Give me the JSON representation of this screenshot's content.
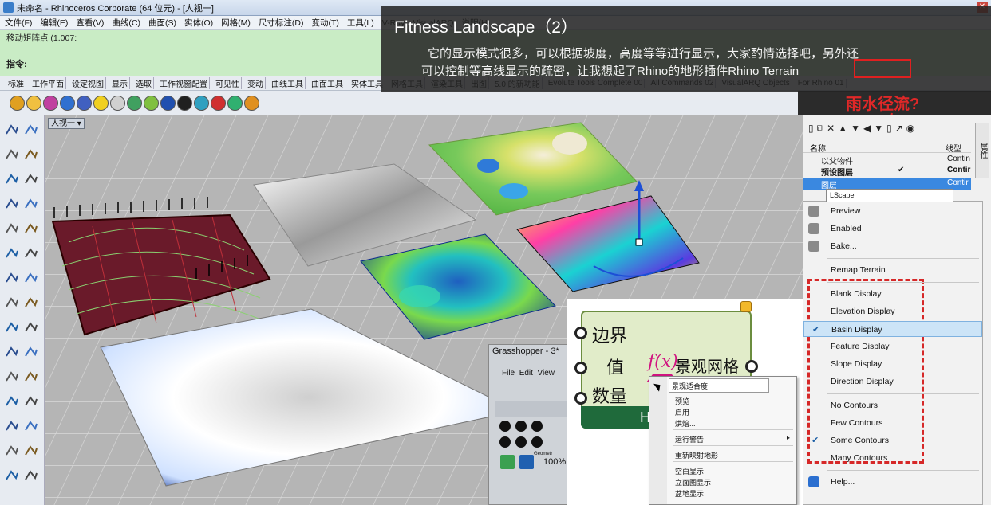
{
  "window": {
    "title": "未命名 - Rhinoceros Corporate (64 位元) - [人视一]",
    "close_glyph": "✕"
  },
  "menu": [
    "文件(F)",
    "编辑(E)",
    "查看(V)",
    "曲线(C)",
    "曲面(S)",
    "实体(O)",
    "网格(M)",
    "尺寸标注(D)",
    "变动(T)",
    "工具(L)",
    "V-Ray",
    "VisualARQ",
    "说明(H)"
  ],
  "command": {
    "history": "移动矩阵点 (1.007:",
    "prompt": "指令:"
  },
  "toolbar_tabs": [
    "标准",
    "工作平面",
    "设定视图",
    "显示",
    "选取",
    "工作视窗配置",
    "可见性",
    "变动",
    "曲线工具",
    "曲面工具",
    "实体工具",
    "网格工具",
    "渲染工具",
    "出图",
    "5.0 的新功能",
    "Evolute Tools Complete 00",
    "All Commands 02",
    "VisualARQ Objects",
    "For Rhino 01"
  ],
  "overlay": {
    "title": "Fitness Landscape（2）",
    "desc_line1": "它的显示模式很多，可以根据坡度，高度等等进行显示，大家酌情选择吧，另外还",
    "desc_line2": "可以控制等高线显示的疏密，让我想起了Rhino的地形插件Rhino Terrain"
  },
  "annotation": "雨水径流?",
  "viewport": {
    "label": "人视一",
    "dropdown": "▾"
  },
  "layers": {
    "toolbar_glyphs": "▯⧉✕▲▼◀▼▯↗◉",
    "col_name": "名称",
    "col_linetype": "线型",
    "side_tab": "属性",
    "rows": [
      {
        "name": "以父物件",
        "linetype": "Contin"
      },
      {
        "name": "预设图层",
        "linetype": "Contir"
      },
      {
        "name": "图层",
        "linetype": "Contir"
      }
    ],
    "check_glyph": "✔"
  },
  "rhino_menu": {
    "nickname": "LScape",
    "items": [
      {
        "label": "Preview",
        "section": 0
      },
      {
        "label": "Enabled",
        "section": 0
      },
      {
        "label": "Bake...",
        "section": 0
      },
      {
        "label": "Remap Terrain",
        "section": 1
      },
      {
        "label": "Blank Display",
        "section": 2
      },
      {
        "label": "Elevation Display",
        "section": 2
      },
      {
        "label": "Basin Display",
        "section": 2,
        "checked": true
      },
      {
        "label": "Feature Display",
        "section": 2
      },
      {
        "label": "Slope Display",
        "section": 2
      },
      {
        "label": "Direction Display",
        "section": 2
      },
      {
        "label": "No Contours",
        "section": 3
      },
      {
        "label": "Few Contours",
        "section": 3
      },
      {
        "label": "Some Contours",
        "section": 3,
        "checked": true
      },
      {
        "label": "Many Contours",
        "section": 3
      },
      {
        "label": "Help...",
        "section": 4
      }
    ],
    "check_glyph": "✔"
  },
  "grasshopper": {
    "title": "Grasshopper - 3*",
    "menu": [
      "File",
      "Edit",
      "View"
    ],
    "zoom": "100%",
    "strip_label": "Geometr"
  },
  "component": {
    "inputs": [
      "边界",
      "值",
      "数量"
    ],
    "output": "景观网格",
    "formula": "f(x)",
    "bottom_label": "He"
  },
  "gh_menu": {
    "nickname": "景观适合度",
    "items": [
      "预览",
      "启用",
      "烘焙...",
      "运行警告",
      "重新映射地形",
      "空白显示",
      "立面图显示",
      "盆地显示"
    ],
    "submenu_glyph": "▸"
  },
  "colors": {
    "accent_red": "#d62828",
    "selection_blue": "#3a88e0",
    "component_green": "#1f6a3b",
    "command_green": "#c9ecc5"
  }
}
